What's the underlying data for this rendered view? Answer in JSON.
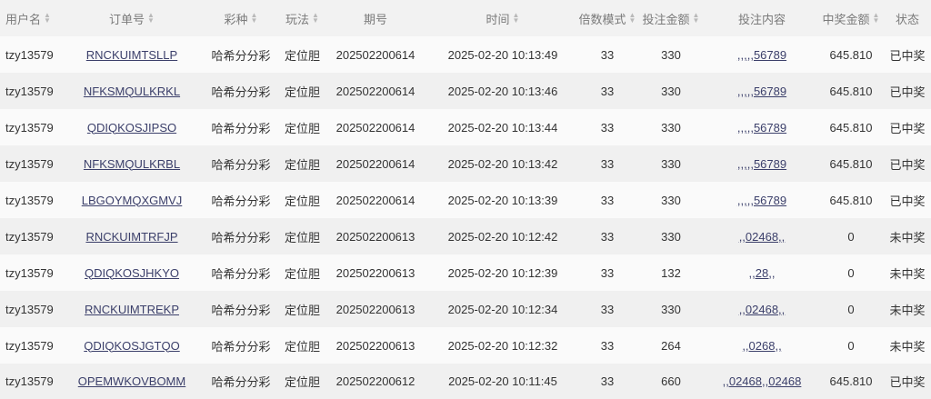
{
  "headers": {
    "user": "用户名",
    "order": "订单号",
    "lottery": "彩种",
    "play": "玩法",
    "issue": "期号",
    "time": "时间",
    "multiple": "倍数模式",
    "amount": "投注金额",
    "content": "投注内容",
    "win": "中奖金额",
    "status": "状态"
  },
  "rows": [
    {
      "user": "tzy13579",
      "order": "RNCKUIMTSLLP",
      "lottery": "哈希分分彩",
      "play": "定位胆",
      "issue": "202502200614",
      "time": "2025-02-20 10:13:49",
      "multiple": "33",
      "amount": "330",
      "content": ",,,,,56789",
      "win": "645.810",
      "status": "已中奖"
    },
    {
      "user": "tzy13579",
      "order": "NFKSMQULKRKL",
      "lottery": "哈希分分彩",
      "play": "定位胆",
      "issue": "202502200614",
      "time": "2025-02-20 10:13:46",
      "multiple": "33",
      "amount": "330",
      "content": ",,,,,56789",
      "win": "645.810",
      "status": "已中奖"
    },
    {
      "user": "tzy13579",
      "order": "QDIQKOSJIPSO",
      "lottery": "哈希分分彩",
      "play": "定位胆",
      "issue": "202502200614",
      "time": "2025-02-20 10:13:44",
      "multiple": "33",
      "amount": "330",
      "content": ",,,,,56789",
      "win": "645.810",
      "status": "已中奖"
    },
    {
      "user": "tzy13579",
      "order": "NFKSMQULKRBL",
      "lottery": "哈希分分彩",
      "play": "定位胆",
      "issue": "202502200614",
      "time": "2025-02-20 10:13:42",
      "multiple": "33",
      "amount": "330",
      "content": ",,,,,56789",
      "win": "645.810",
      "status": "已中奖"
    },
    {
      "user": "tzy13579",
      "order": "LBGOYMQXGMVJ",
      "lottery": "哈希分分彩",
      "play": "定位胆",
      "issue": "202502200614",
      "time": "2025-02-20 10:13:39",
      "multiple": "33",
      "amount": "330",
      "content": ",,,,,56789",
      "win": "645.810",
      "status": "已中奖"
    },
    {
      "user": "tzy13579",
      "order": "RNCKUIMTRFJP",
      "lottery": "哈希分分彩",
      "play": "定位胆",
      "issue": "202502200613",
      "time": "2025-02-20 10:12:42",
      "multiple": "33",
      "amount": "330",
      "content": ",,02468,,",
      "win": "0",
      "status": "未中奖"
    },
    {
      "user": "tzy13579",
      "order": "QDIQKOSJHKYO",
      "lottery": "哈希分分彩",
      "play": "定位胆",
      "issue": "202502200613",
      "time": "2025-02-20 10:12:39",
      "multiple": "33",
      "amount": "132",
      "content": ",,28,,",
      "win": "0",
      "status": "未中奖"
    },
    {
      "user": "tzy13579",
      "order": "RNCKUIMTREKP",
      "lottery": "哈希分分彩",
      "play": "定位胆",
      "issue": "202502200613",
      "time": "2025-02-20 10:12:34",
      "multiple": "33",
      "amount": "330",
      "content": ",,02468,,",
      "win": "0",
      "status": "未中奖"
    },
    {
      "user": "tzy13579",
      "order": "QDIQKOSJGTQO",
      "lottery": "哈希分分彩",
      "play": "定位胆",
      "issue": "202502200613",
      "time": "2025-02-20 10:12:32",
      "multiple": "33",
      "amount": "264",
      "content": ",,0268,,",
      "win": "0",
      "status": "未中奖"
    },
    {
      "user": "tzy13579",
      "order": "OPEMWKOVBOMM",
      "lottery": "哈希分分彩",
      "play": "定位胆",
      "issue": "202502200612",
      "time": "2025-02-20 10:11:45",
      "multiple": "33",
      "amount": "660",
      "content": ",,02468,,02468",
      "win": "645.810",
      "status": "已中奖"
    }
  ]
}
